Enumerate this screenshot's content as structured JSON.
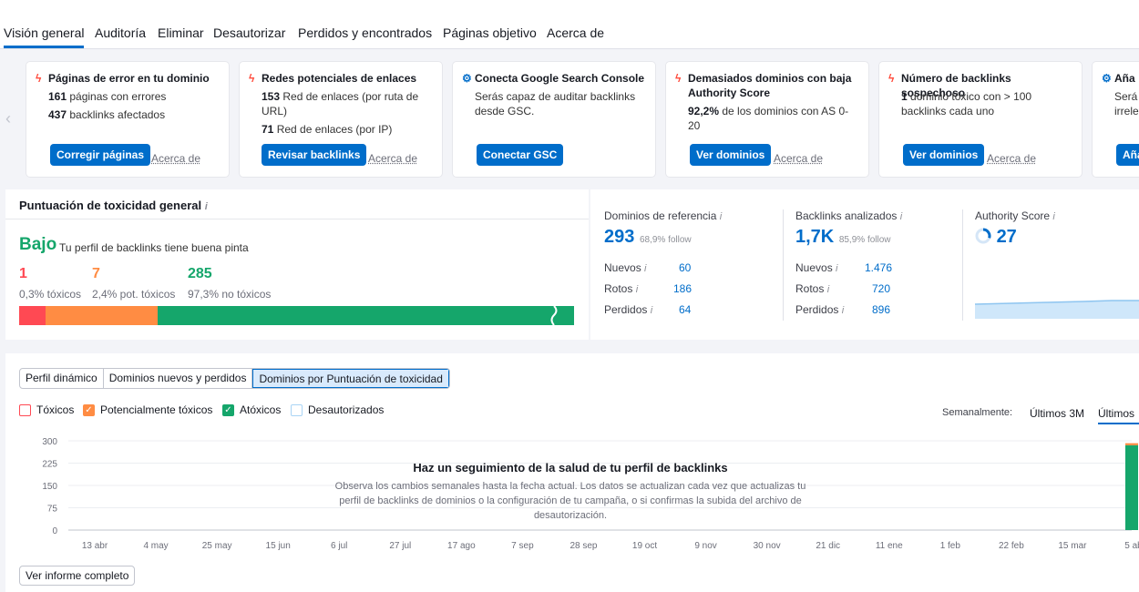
{
  "tabs": [
    "Visión general",
    "Auditoría",
    "Eliminar",
    "Desautorizar",
    "Perdidos y encontrados",
    "Páginas objetivo",
    "Acerca de"
  ],
  "cards": [
    {
      "title": "Páginas de error en tu dominio",
      "icon": "bolt-icon",
      "lines": [
        {
          "n": "161",
          "t": " páginas con errores"
        },
        {
          "n": "437",
          "t": " backlinks afectados"
        }
      ],
      "button": "Corregir páginas",
      "link": "Acerca de"
    },
    {
      "title": "Redes potenciales de enlaces",
      "icon": "bolt-icon",
      "lines": [
        {
          "n": "153",
          "t": " Red de enlaces (por ruta de URL)"
        },
        {
          "n": "71",
          "t": " Red de enlaces (por IP)"
        }
      ],
      "button": "Revisar backlinks",
      "link": "Acerca de"
    },
    {
      "title": "Conecta Google Search Console",
      "icon": "gear-icon",
      "lines": [
        {
          "n": "",
          "t": "Serás capaz de auditar backlinks desde GSC."
        }
      ],
      "button": "Conectar GSC",
      "link": ""
    },
    {
      "title": "Demasiados dominios con baja Authority Score",
      "icon": "bolt-icon",
      "lines": [
        {
          "n": "92,2%",
          "t": " de los dominios con AS 0-20"
        }
      ],
      "button": "Ver dominios",
      "link": "Acerca de"
    },
    {
      "title": "Número de backlinks sospechoso",
      "icon": "bolt-icon",
      "lines": [
        {
          "n": "1",
          "t": " dominio tóxico con > 100 backlinks cada uno"
        }
      ],
      "button": "Ver dominios",
      "link": "Acerca de"
    },
    {
      "title": "Aña",
      "icon": "gear-icon",
      "lines": [
        {
          "n": "",
          "t": "Será irrele"
        }
      ],
      "button": "Aña",
      "link": ""
    }
  ],
  "toxicity": {
    "title": "Puntuación de toxicidad general",
    "level": "Bajo",
    "level_text": "Tu perfil de backlinks tiene buena pinta",
    "counts": [
      {
        "value": "1",
        "label": "0,3% tóxicos",
        "color": "#ff4953",
        "share": 0.003
      },
      {
        "value": "7",
        "label": "2,4% pot. tóxicos",
        "color": "#ff8c43",
        "share": 0.024
      },
      {
        "value": "285",
        "label": "97,3% no tóxicos",
        "color": "#15a66b",
        "share": 0.973
      }
    ]
  },
  "stats": {
    "ref_domains": {
      "title": "Dominios de referencia",
      "value": "293",
      "sub": "68,9% follow",
      "rows": [
        {
          "label": "Nuevos",
          "value": "60"
        },
        {
          "label": "Rotos",
          "value": "186"
        },
        {
          "label": "Perdidos",
          "value": "64"
        }
      ]
    },
    "backlinks": {
      "title": "Backlinks analizados",
      "value": "1,7K",
      "sub": "85,9% follow",
      "rows": [
        {
          "label": "Nuevos",
          "value": "1.476"
        },
        {
          "label": "Rotos",
          "value": "720"
        },
        {
          "label": "Perdidos",
          "value": "896"
        }
      ]
    },
    "authority": {
      "title": "Authority Score",
      "value": "27"
    }
  },
  "chart_section": {
    "views": [
      "Perfil dinámico",
      "Dominios nuevos y perdidos",
      "Dominios por Puntuación de toxicidad"
    ],
    "selected_view": 2,
    "filters": [
      {
        "label": "Tóxicos",
        "checked": false,
        "color": "#ff4953"
      },
      {
        "label": "Potencialmente tóxicos",
        "checked": true,
        "color": "#ff8c43"
      },
      {
        "label": "Atóxicos",
        "checked": true,
        "color": "#15a66b"
      },
      {
        "label": "Desautorizados",
        "checked": false,
        "color": "#a9d4f5"
      }
    ],
    "period_label": "Semanalmente:",
    "periods": [
      "Últimos 3M",
      "Últimos"
    ],
    "overlay_title": "Haz un seguimiento de la salud de tu perfil de backlinks",
    "overlay_text": "Observa los cambios semanales hasta la fecha actual. Los datos se actualizan cada vez que actualizas tu perfil de backlinks de dominios o la configuración de tu campaña, o si confirmas la subida del archivo de desautorización.",
    "full_report_button": "Ver informe completo"
  },
  "chart_data": {
    "type": "bar",
    "title": "",
    "xlabel": "",
    "ylabel": "",
    "ylim": [
      0,
      300
    ],
    "yticks": [
      "300",
      "225",
      "150",
      "75",
      "0"
    ],
    "categories": [
      "13 abr",
      "4 may",
      "25 may",
      "15 jun",
      "6 jul",
      "27 jul",
      "17 ago",
      "7 sep",
      "28 sep",
      "19 oct",
      "9 nov",
      "30 nov",
      "21 dic",
      "11 ene",
      "1 feb",
      "22 feb",
      "15 mar",
      "5 ab"
    ],
    "series": [
      {
        "name": "Atóxicos",
        "color": "#15a66b",
        "values": [
          0,
          0,
          0,
          0,
          0,
          0,
          0,
          0,
          0,
          0,
          0,
          0,
          0,
          0,
          0,
          0,
          0,
          285
        ]
      },
      {
        "name": "Potencialmente tóxicos",
        "color": "#ff8c43",
        "values": [
          0,
          0,
          0,
          0,
          0,
          0,
          0,
          0,
          0,
          0,
          0,
          0,
          0,
          0,
          0,
          0,
          0,
          7
        ]
      }
    ]
  }
}
